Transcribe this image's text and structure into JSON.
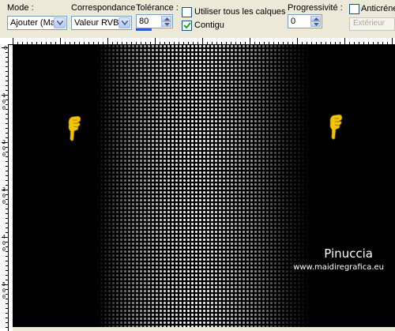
{
  "toolbar": {
    "mode_label": "Mode :",
    "mode_value": "Ajouter (Maj)",
    "match_label": "Correspondance :",
    "match_value": "Valeur RVB",
    "tolerance_label": "Tolérance :",
    "tolerance_value": "80",
    "use_all_layers_label": "Utiliser tous les calques",
    "contiguous_label": "Contigu",
    "feather_label": "Progressivité :",
    "feather_value": "0",
    "antialias_label": "Anticrénel",
    "exterior_label": "Extérieur",
    "use_all_layers_checked": false,
    "contiguous_checked": true,
    "antialias_checked": false
  },
  "rulers": {
    "top_numbers": [
      "0"
    ],
    "left_numbers": [
      {
        "digits": [
          "0"
        ]
      },
      {
        "digits": [
          "1",
          "0",
          "0"
        ]
      },
      {
        "digits": [
          "2",
          "0",
          "0"
        ]
      },
      {
        "digits": [
          "3",
          "0",
          "0"
        ]
      },
      {
        "digits": [
          "4",
          "0",
          "0"
        ]
      },
      {
        "digits": [
          "5",
          "0",
          "0"
        ]
      }
    ]
  },
  "canvas": {
    "watermark_title": "Pinuccia",
    "watermark_url": "www.maidiregrafica.eu",
    "pointer_icon": "pointing-hand-icon",
    "background_color": "#000000",
    "pattern_color": "#ffffff"
  }
}
